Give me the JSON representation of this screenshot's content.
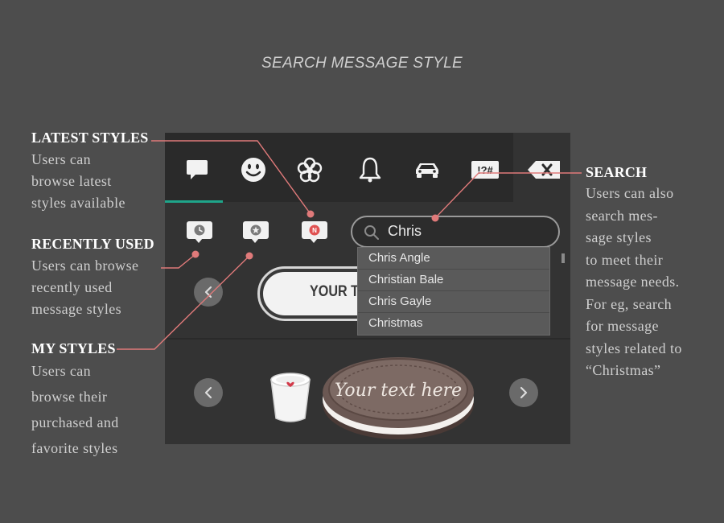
{
  "title": "SEARCH MESSAGE STYLE",
  "annotations": {
    "latest": {
      "heading": "LATEST STYLES",
      "lines": [
        "Users can",
        "browse latest",
        "styles available"
      ]
    },
    "recent": {
      "heading": "RECENTLY USED",
      "lines": [
        "Users can browse",
        "recently used",
        "message styles"
      ]
    },
    "mystyles": {
      "heading": "MY STYLES",
      "lines": [
        "Users can",
        "browse their",
        "purchased and",
        "favorite styles"
      ]
    },
    "search": {
      "heading": "SEARCH",
      "lines": [
        "Users can also",
        "search mes-",
        "sage styles",
        "to meet their",
        "message needs.",
        "For eg, search",
        "for message",
        "styles related to",
        "“Christmas”"
      ]
    }
  },
  "panel": {
    "category_icons": [
      "message-icon",
      "smiley-icon",
      "flower-icon",
      "bell-icon",
      "car-icon",
      "symbols-icon",
      "backspace-icon"
    ],
    "symbols_label": "!?#",
    "sub_icons": [
      "recent-icon",
      "favorite-icon",
      "new-icon"
    ],
    "new_badge": "N",
    "search": {
      "value": "Chris"
    },
    "suggestions": [
      "Chris Angle",
      "Christian Bale",
      "Chris Gayle",
      "Christmas"
    ],
    "sticker_text": "YOUR T",
    "cookie_text": "Your text here"
  },
  "colors": {
    "accent": "#1fa58a",
    "annotation_line": "#e07a7a",
    "background": "#4d4d4d"
  }
}
